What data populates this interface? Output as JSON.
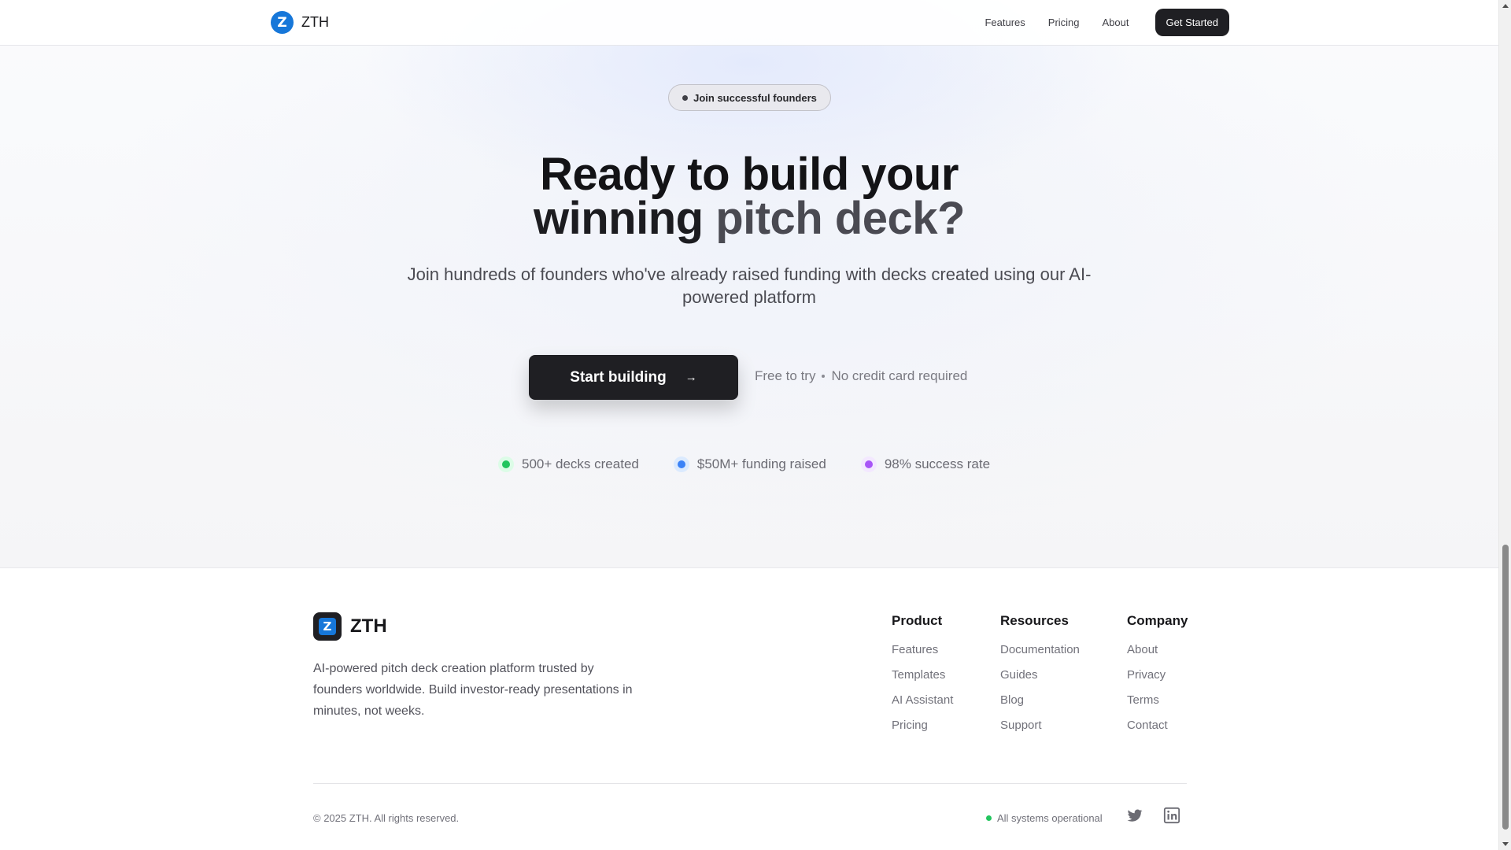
{
  "nav": {
    "brand": "ZTH",
    "logo_letter": "Z",
    "links": [
      "Features",
      "Pricing",
      "About"
    ],
    "cta": "Get Started"
  },
  "hero": {
    "badge": "Join successful founders",
    "headline_line1": "Ready to build your",
    "headline_line2a": "winning ",
    "headline_line2b": "pitch deck?",
    "subhead": "Join hundreds of founders who've already raised funding with decks created using our AI-powered platform",
    "cta_label": "Start building",
    "cta_arrow": "→",
    "note_a": "Free to try",
    "note_b": "No credit card required",
    "stats": [
      {
        "label": "500+ decks created",
        "color": "#22c55e",
        "ring": "#dcfce7"
      },
      {
        "label": "$50M+ funding raised",
        "color": "#3b82f6",
        "ring": "#dbeafe"
      },
      {
        "label": "98% success rate",
        "color": "#a855f7",
        "ring": "#f3e8ff"
      }
    ]
  },
  "footer": {
    "brand": "ZTH",
    "logo_letter": "Z",
    "description": "AI-powered pitch deck creation platform trusted by founders worldwide. Build investor-ready presentations in minutes, not weeks.",
    "columns": [
      {
        "title": "Product",
        "items": [
          "Features",
          "Templates",
          "AI Assistant",
          "Pricing"
        ]
      },
      {
        "title": "Resources",
        "items": [
          "Documentation",
          "Guides",
          "Blog",
          "Support"
        ]
      },
      {
        "title": "Company",
        "items": [
          "About",
          "Privacy",
          "Terms",
          "Contact"
        ]
      }
    ],
    "copyright": "© 2025 ZTH. All rights reserved.",
    "status": "All systems operational",
    "social": [
      "twitter-icon",
      "linkedin-icon"
    ]
  },
  "colors": {
    "accent": "#1677d9",
    "dark": "#1f1f23",
    "status_ok": "#22c55e"
  }
}
